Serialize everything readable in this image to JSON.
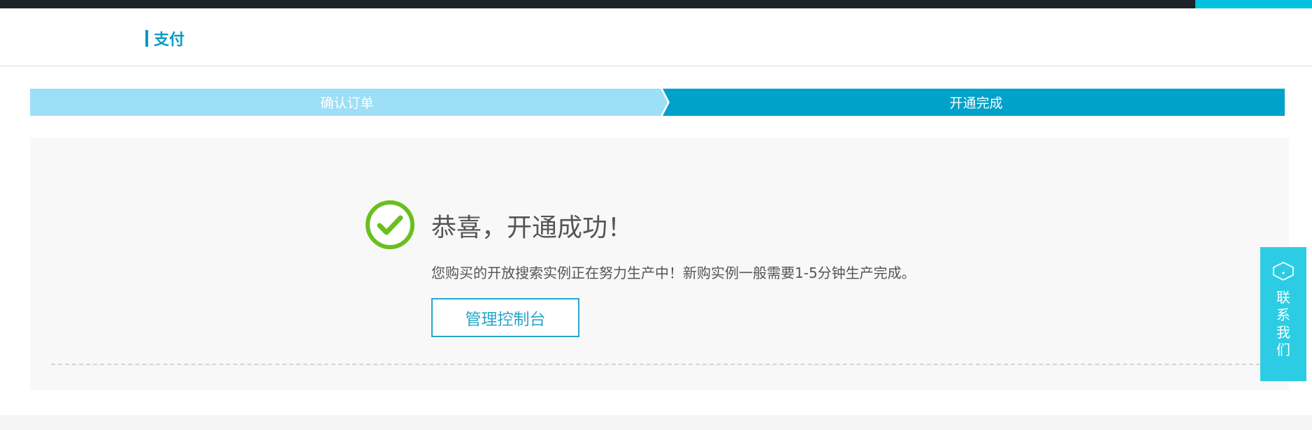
{
  "header": {
    "title": "支付"
  },
  "steps": [
    {
      "label": "确认订单",
      "state": "completed"
    },
    {
      "label": "开通完成",
      "state": "active"
    }
  ],
  "result": {
    "icon": "check-circle-icon",
    "title": "恭喜，开通成功！",
    "description": "您购买的开放搜索实例正在努力生产中！新购实例一般需要1-5分钟生产完成。",
    "console_button_label": "管理控制台"
  },
  "contact_widget": {
    "icon": "chat-icon",
    "label": "联系我们"
  },
  "colors": {
    "top_bar": "#1c2328",
    "top_bar_accent": "#00c1de",
    "brand": "#0a9ac4",
    "step_completed": "#9ddff6",
    "step_active": "#00a2ca",
    "success_green": "#6abf1e",
    "button_accent": "#27a6cd",
    "contact_widget": "#2ccde4"
  }
}
